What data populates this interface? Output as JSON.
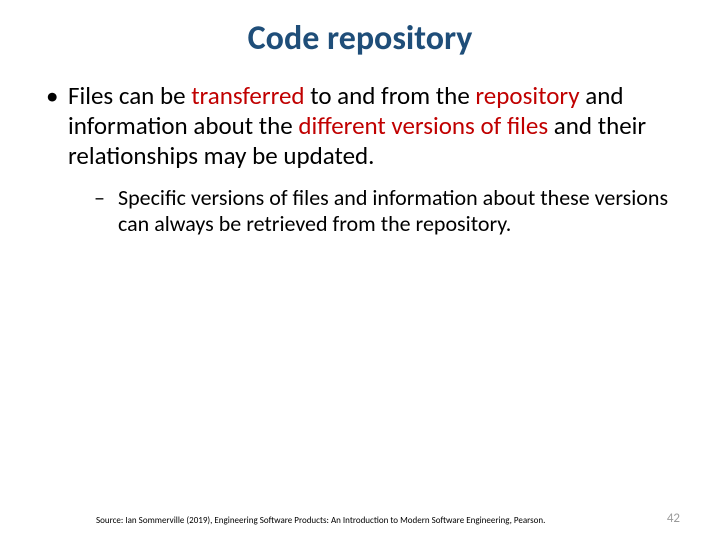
{
  "title": "Code repository",
  "bullet1": {
    "seg1": "Files can be ",
    "seg2_red": "transferred",
    "seg3": " to and from the ",
    "seg4_red": "repository",
    "seg5": " and information about the ",
    "seg6_red": "different versions of files",
    "seg7": " and their relationships may be updated."
  },
  "sub1": "Specific versions of files and information about these versions can always be retrieved from the repository.",
  "source": "Source: Ian Sommerville (2019), Engineering Software Products: An Introduction to Modern Software Engineering, Pearson.",
  "page": "42"
}
